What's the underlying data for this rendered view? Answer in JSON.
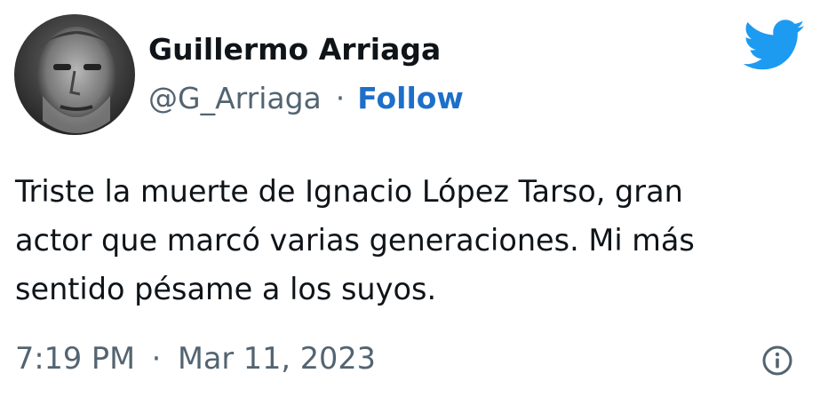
{
  "author": {
    "display_name": "Guillermo Arriaga",
    "handle": "@G_Arriaga",
    "separator": "·",
    "follow_label": "Follow",
    "avatar_icon": "avatar-photo"
  },
  "tweet": {
    "lines": [
      "Triste la muerte de Ignacio López Tarso, gran",
      "actor que marcó varias generaciones. Mi más",
      "sentido pésame a los suyos."
    ]
  },
  "meta": {
    "time": "7:19 PM",
    "separator": "·",
    "date": "Mar 11, 2023"
  },
  "icons": {
    "brand": "twitter-bird-icon",
    "info": "info-icon"
  },
  "colors": {
    "brand": "#1d9bf0",
    "link": "#1d6fc9",
    "text": "#0f1419",
    "muted": "#536471"
  }
}
